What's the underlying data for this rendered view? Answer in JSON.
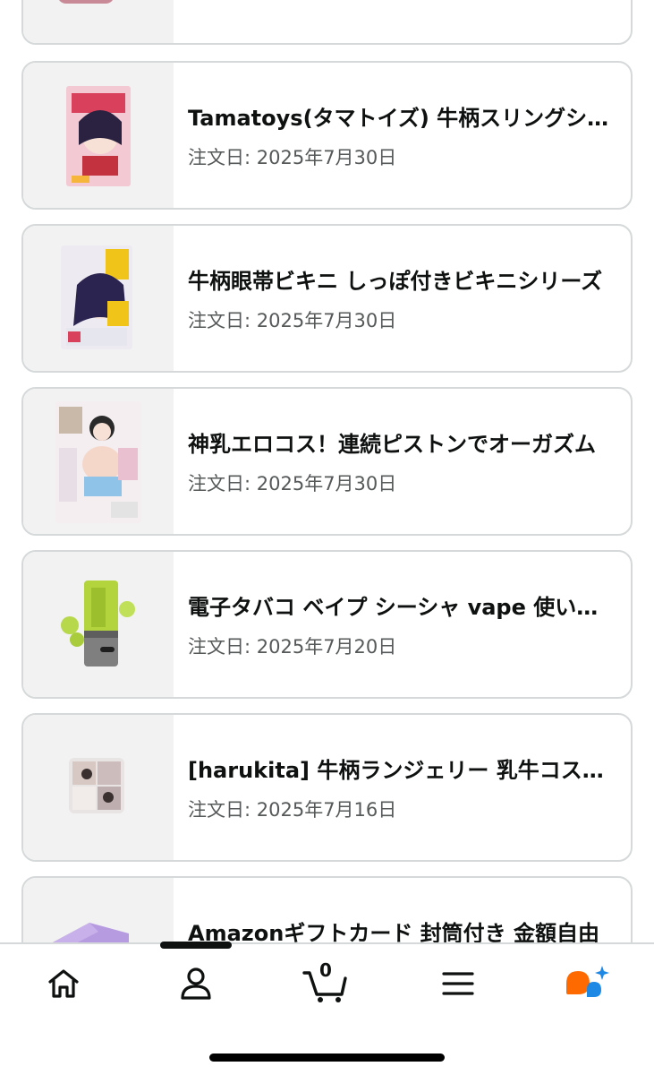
{
  "orders": [
    {
      "title": "",
      "date": ""
    },
    {
      "title": "Tamatoys(タマトイズ) 牛柄スリングショット",
      "date": "注文日: 2025年7月30日"
    },
    {
      "title": "牛柄眼帯ビキニ しっぽ付きビキニシリーズ",
      "date": "注文日: 2025年7月30日"
    },
    {
      "title": "神乳エロコス！連続ピストンでオーガズム",
      "date": "注文日: 2025年7月30日"
    },
    {
      "title": "電子タバコ ベイプ シーシャ vape 使い捨て",
      "date": "注文日: 2025年7月20日"
    },
    {
      "title": "[harukita] 牛柄ランジェリー 乳牛コスプレ",
      "date": "注文日: 2025年7月16日"
    },
    {
      "title": "Amazonギフトカード 封筒付き 金額自由",
      "date": ""
    }
  ],
  "nav": {
    "cart_count": "0"
  }
}
